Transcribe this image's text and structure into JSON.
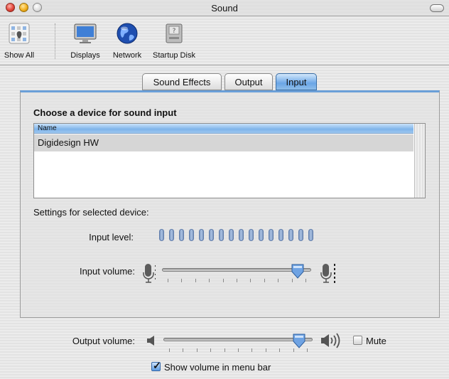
{
  "window": {
    "title": "Sound"
  },
  "toolbar": {
    "items": [
      {
        "label": "Show All",
        "icon": "apple-grid-icon"
      },
      {
        "label": "Displays",
        "icon": "display-icon"
      },
      {
        "label": "Network",
        "icon": "globe-icon"
      },
      {
        "label": "Startup Disk",
        "icon": "disk-icon"
      }
    ]
  },
  "tabs": [
    {
      "label": "Sound Effects",
      "selected": false
    },
    {
      "label": "Output",
      "selected": false
    },
    {
      "label": "Input",
      "selected": true
    }
  ],
  "input_panel": {
    "heading": "Choose a device for sound input",
    "table": {
      "columns": [
        "Name"
      ],
      "rows": [
        {
          "name": "Digidesign HW",
          "selected": true
        }
      ]
    },
    "settings_label": "Settings for selected device:",
    "input_level": {
      "label": "Input level:",
      "segments": 16
    },
    "input_volume": {
      "label": "Input volume:",
      "value": 0.95
    }
  },
  "output": {
    "label": "Output volume:",
    "value": 0.95,
    "mute": {
      "label": "Mute",
      "checked": false
    }
  },
  "menu_bar_checkbox": {
    "label": "Show volume in menu bar",
    "checked": true
  },
  "colors": {
    "accent": "#6aa6e6",
    "header_blue": "#7fb4ea"
  }
}
